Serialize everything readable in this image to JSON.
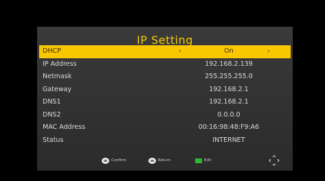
{
  "title": "IP Setting",
  "rows": [
    {
      "label": "DHCP",
      "value": "On",
      "left_arrow": "‹",
      "right_arrow": "›"
    },
    {
      "label": "IP Address",
      "value": "192.168.2.139"
    },
    {
      "label": "Netmask",
      "value": "255.255.255.0"
    },
    {
      "label": "Gateway",
      "value": "192.168.2.1"
    },
    {
      "label": "DNS1",
      "value": "192.168.2.1"
    },
    {
      "label": "DNS2",
      "value": "0.0.0.0"
    },
    {
      "label": "MAC Address",
      "value": "00:16:98:48:F9:A6"
    },
    {
      "label": "Status",
      "value": "INTERNET"
    }
  ],
  "footer": {
    "confirm_label": "Confirm",
    "return_label": "Return",
    "edit_label": "Edit"
  },
  "icons": {
    "confirm": "ok-key-icon",
    "return": "exit-key-icon",
    "edit": "green-key-icon",
    "navigate": "dpad-navigation-icon"
  },
  "colors": {
    "accent": "#f9c800",
    "title": "#f7cf00",
    "panel": "#333333",
    "edit_key": "#2fb82f"
  }
}
